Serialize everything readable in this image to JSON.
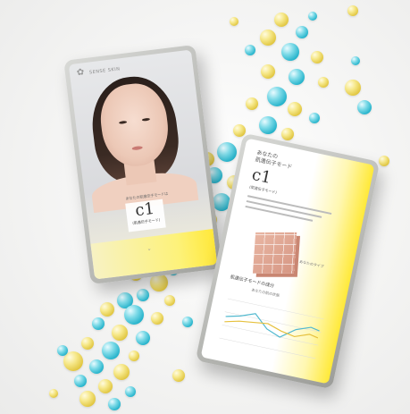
{
  "colors": {
    "accent_yellow": "#ffe938",
    "bubble_yellow": "#e1c640",
    "bubble_cyan": "#25b3cb",
    "phone_body": "#b9bab6"
  },
  "phone_left": {
    "logo_text": "SENSE SKIN",
    "subtitle": "あなたの肌遺伝子モードは",
    "code": "c1",
    "code_label": "(肌遺伝子モード)"
  },
  "phone_right": {
    "title_line1": "あなたの",
    "title_line2": "肌遺伝子モード",
    "code": "c1",
    "code_label": "(肌遺伝子モード)",
    "cube_label": "あなたのタイプ",
    "section_title": "肌遺伝子モードの成分",
    "chart_label": "あなたの肌の状態"
  }
}
